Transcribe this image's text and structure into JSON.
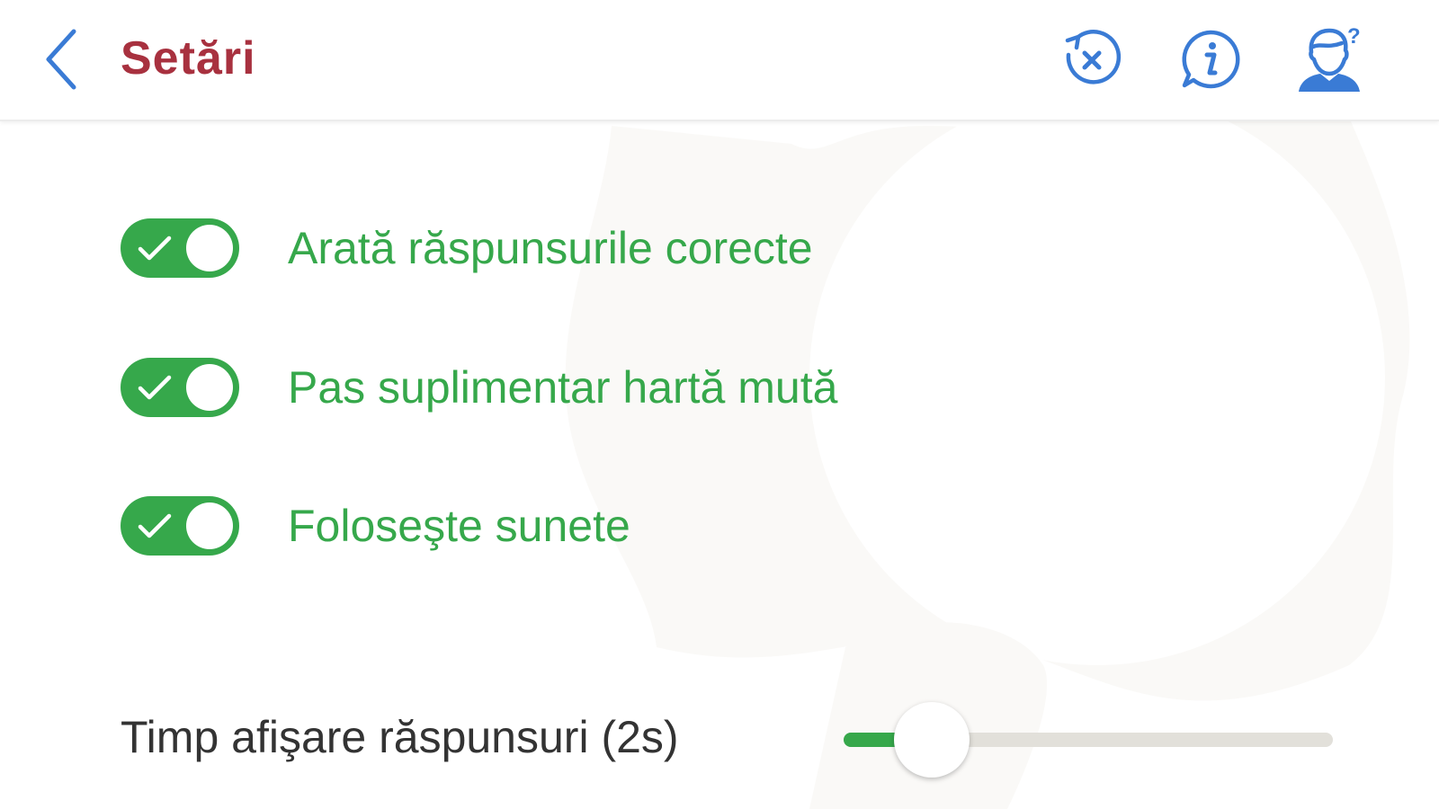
{
  "header": {
    "back_icon": "chevron-left-icon",
    "title": "Setări",
    "actions": [
      {
        "icon": "reset-progress-icon"
      },
      {
        "icon": "info-icon"
      },
      {
        "icon": "instructor-help-icon"
      }
    ]
  },
  "settings": {
    "toggles": [
      {
        "label": "Arată răspunsurile corecte",
        "checked": true
      },
      {
        "label": "Pas suplimentar hartă mută",
        "checked": true
      },
      {
        "label": "Foloseşte sunete",
        "checked": true
      }
    ],
    "slider": {
      "label": "Timp afişare răspunsuri (2s)",
      "value_fraction": 0.18
    }
  },
  "colors": {
    "title": "#a8313f",
    "accent_blue": "#3a7bd5",
    "accent_green": "#36a84b",
    "track": "#e2e0da"
  }
}
